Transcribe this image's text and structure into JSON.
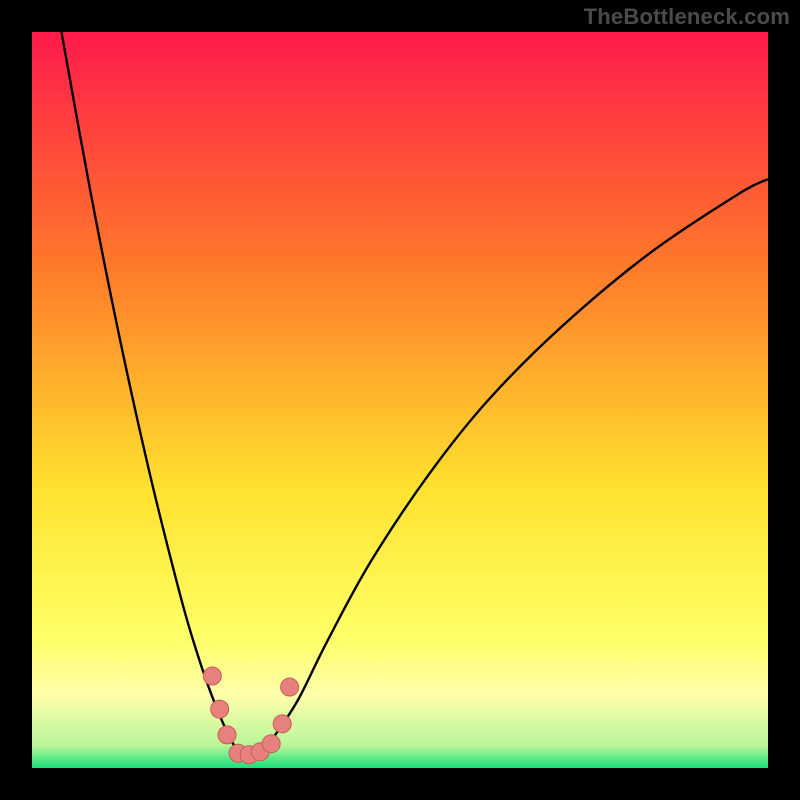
{
  "watermark": "TheBottleneck.com",
  "colors": {
    "frame": "#000000",
    "gradient_top": "#ff1a4b",
    "gradient_mid_upper": "#ff7a2a",
    "gradient_mid": "#ffe22e",
    "gradient_low_band": "#ffffaa",
    "gradient_bottom": "#18e07a",
    "curve": "#000000",
    "marker_fill": "#e7817d",
    "marker_stroke": "#c95c57"
  },
  "chart_data": {
    "type": "line",
    "title": "",
    "xlabel": "",
    "ylabel": "",
    "xlim": [
      0,
      100
    ],
    "ylim": [
      0,
      100
    ],
    "grid": false,
    "legend": false,
    "description": "Bottleneck-style V-curve. Left branch descends steeply from top-left toward the trough near x≈28, right branch rises with decreasing slope toward top-right. Background is a vertical red→orange→yellow→pale-yellow→green gradient. A small cluster of pink markers sits near the trough.",
    "series": [
      {
        "name": "left_branch",
        "x": [
          4,
          8,
          12,
          16,
          20,
          22,
          24,
          26,
          28
        ],
        "values": [
          100,
          78,
          58,
          40,
          24,
          17,
          11,
          6,
          2
        ]
      },
      {
        "name": "right_branch",
        "x": [
          32,
          36,
          40,
          46,
          54,
          62,
          72,
          84,
          96,
          100
        ],
        "values": [
          3,
          9,
          17,
          28,
          40,
          50,
          60,
          70,
          78,
          80
        ]
      }
    ],
    "markers": {
      "name": "trough_markers",
      "x": [
        24.5,
        25.5,
        26.5,
        28.0,
        29.5,
        31.0,
        32.5,
        34.0,
        35.0
      ],
      "values": [
        12.5,
        8.0,
        4.5,
        2.0,
        1.8,
        2.2,
        3.3,
        6.0,
        11.0
      ]
    }
  }
}
